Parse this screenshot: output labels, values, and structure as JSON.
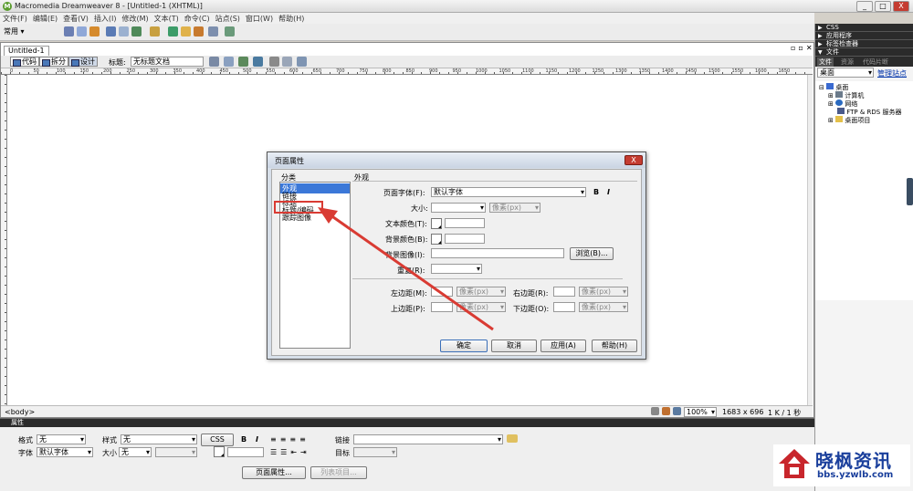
{
  "window": {
    "title": "Macromedia Dreamweaver 8 - [Untitled-1 (XHTML)]",
    "controls": [
      "_",
      "□",
      "X"
    ]
  },
  "menu": [
    "文件(F)",
    "编辑(E)",
    "查看(V)",
    "插入(I)",
    "修改(M)",
    "文本(T)",
    "命令(C)",
    "站点(S)",
    "窗口(W)",
    "帮助(H)"
  ],
  "insertbar": {
    "category": "常用"
  },
  "document": {
    "tab": "Untitled-1",
    "views": [
      "代码",
      "拆分",
      "设计"
    ],
    "title_label": "标题:",
    "title_value": "无标题文档",
    "ruler_labels": [
      "0",
      "50",
      "100",
      "150",
      "200",
      "250",
      "300",
      "350",
      "400",
      "450",
      "500",
      "550",
      "600",
      "650",
      "700",
      "750",
      "800",
      "850",
      "900",
      "950",
      "1000",
      "1050",
      "1100",
      "1150",
      "1200",
      "1250",
      "1300",
      "1350",
      "1400",
      "1450",
      "1500",
      "1550",
      "1600",
      "1650"
    ],
    "status_tag": "<body>",
    "zoom": "100%",
    "size": "1683 x 696",
    "weight": "1 K / 1 秒"
  },
  "panels": {
    "groups": [
      "CSS",
      "应用程序",
      "标签检查器"
    ],
    "files": {
      "header": "文件",
      "tabs": [
        "文件",
        "资源",
        "代码片断"
      ],
      "location": "桌面",
      "manage_link": "管理站点",
      "tree": [
        "桌面",
        "计算机",
        "网络",
        "FTP & RDS 服务器",
        "桌面项目"
      ]
    }
  },
  "properties": {
    "header": "属性",
    "format_label": "格式",
    "format_value": "无",
    "style_label": "样式",
    "style_value": "无",
    "css_button": "CSS",
    "bold": "B",
    "italic": "I",
    "link_label": "链接",
    "font_label": "字体",
    "font_value": "默认字体",
    "size_label": "大小",
    "size_value": "无",
    "target_label": "目标",
    "page_props_button": "页面属性...",
    "list_item_button": "列表项目..."
  },
  "dialog": {
    "title": "页面属性",
    "close": "X",
    "category_label": "分类",
    "categories": [
      "外观",
      "链接",
      "标题",
      "标题/编码",
      "跟踪图像"
    ],
    "selected_category": "外观",
    "section_title": "外观",
    "font_label": "页面字体(F):",
    "font_value": "默认字体",
    "bold": "B",
    "italic": "I",
    "size_label": "大小:",
    "unit_px": "像素(px)",
    "text_color_label": "文本颜色(T):",
    "bg_color_label": "背景颜色(B):",
    "bg_image_label": "背景图像(I):",
    "browse_button": "浏览(B)...",
    "repeat_label": "重复(R):",
    "left_margin_label": "左边距(M):",
    "right_margin_label": "右边距(R):",
    "top_margin_label": "上边距(P):",
    "bottom_margin_label": "下边距(O):",
    "ok": "确定",
    "cancel": "取消",
    "apply": "应用(A)",
    "help": "帮助(H)"
  },
  "annotation": {
    "highlight_color": "#d93b33"
  },
  "watermark": {
    "brand": "晓枫资讯",
    "url": "bbs.yzwlb.com"
  }
}
